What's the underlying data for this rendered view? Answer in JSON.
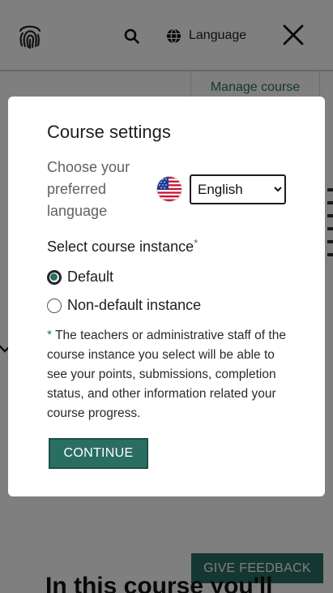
{
  "header": {
    "logo_icon": "fingerprint-icon",
    "search_icon": "search-icon",
    "language_icon": "globe-icon",
    "language_label": "Language",
    "close_icon": "close-icon"
  },
  "background": {
    "manage_course_tab": "Manage course",
    "feedback_button": "GIVE FEEDBACK",
    "section_heading": "In this course you'll"
  },
  "modal": {
    "title": "Course settings",
    "language_prompt": "Choose your preferred language",
    "flag_icon": "us-flag-icon",
    "language_select": {
      "selected": "English",
      "options": [
        "English"
      ]
    },
    "instance_label": "Select course instance",
    "required_marker": "*",
    "instances": [
      {
        "label": "Default",
        "selected": true
      },
      {
        "label": "Non-default instance",
        "selected": false
      }
    ],
    "note_star": "*",
    "note_text": " The teachers or administrative staff of the course instance you select will be able to see your points, submissions, completion status, and other information related your course progress.",
    "continue_label": "CONTINUE"
  },
  "colors": {
    "brand_green": "#2a6e63",
    "overlay": "rgba(0,0,0,0.5)"
  }
}
